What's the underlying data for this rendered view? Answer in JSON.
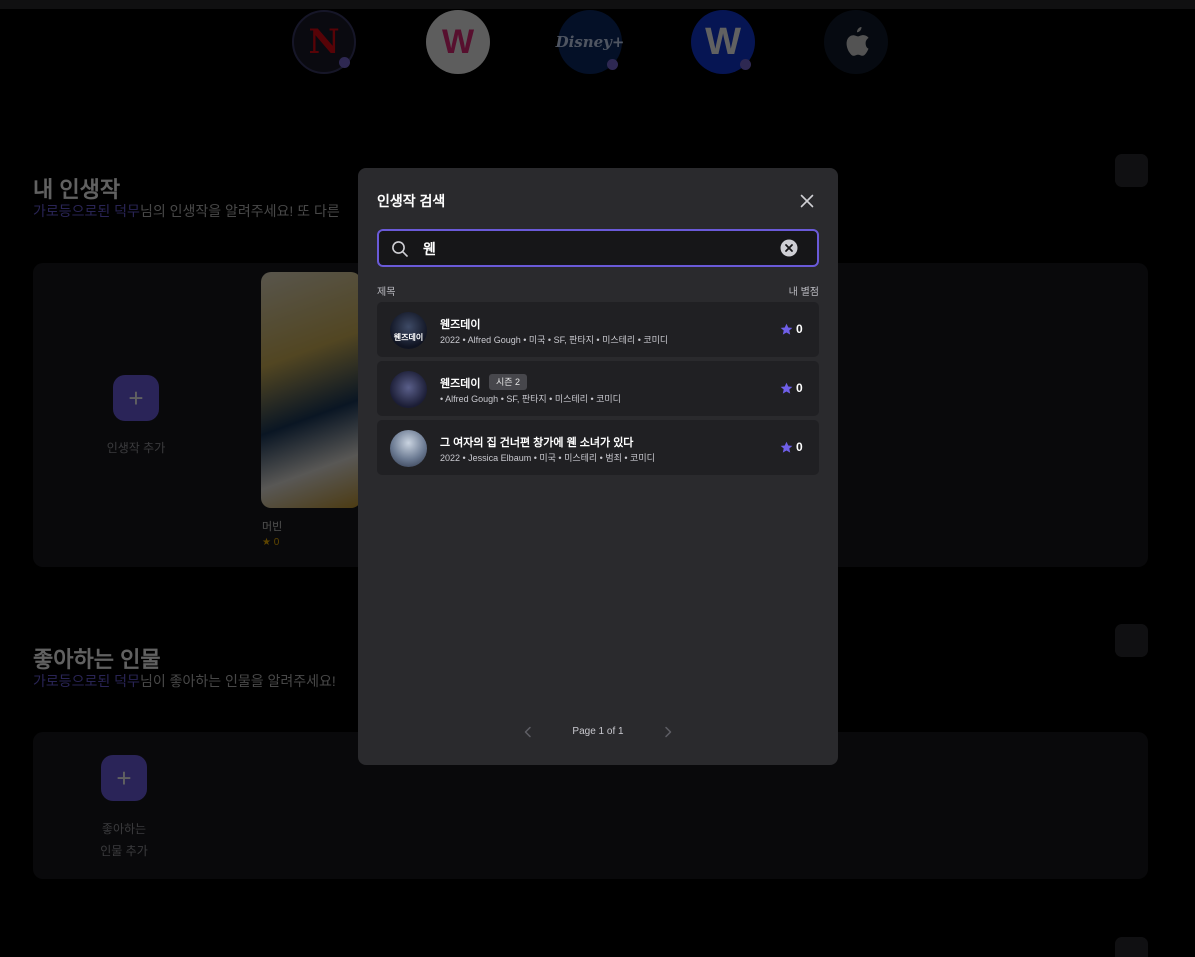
{
  "background": {
    "ott_services": [
      {
        "name": "netflix-logo-icon",
        "glyph": "N"
      },
      {
        "name": "wavve-logo-icon",
        "glyph": "W"
      },
      {
        "name": "disney-plus-logo-icon",
        "glyph": "Disney+"
      },
      {
        "name": "watcha-logo-icon",
        "glyph": "W"
      },
      {
        "name": "apple-tv-logo-icon",
        "glyph": ""
      }
    ],
    "section1": {
      "title": "내 인생작",
      "subtitle_highlight": "가로등으로된 덕무",
      "subtitle_rest": "님의 인생작을 알려주세요! 또 다른",
      "add_label": "인생작 추가",
      "poster_caption": "머빈",
      "poster_rating": "★ 0"
    },
    "section2": {
      "title": "좋아하는 인물",
      "subtitle_highlight": "가로등으로된 덕무",
      "subtitle_rest": "님이 좋아하는 인물을 알려주세요!",
      "add_label_line1": "좋아하는",
      "add_label_line2": "인물 추가"
    }
  },
  "modal": {
    "title": "인생작 검색",
    "search": {
      "value": "웬",
      "placeholder": ""
    },
    "columns": {
      "title": "제목",
      "rating": "내 별점"
    },
    "results": [
      {
        "title": "웬즈데이",
        "badge": "",
        "meta": "2022 • Alfred Gough • 미국 • SF, 판타지 • 미스테리 • 코미디",
        "thumb_text": "웬즈데이",
        "rating": "0"
      },
      {
        "title": "웬즈데이",
        "badge": "시즌 2",
        "meta": "• Alfred Gough • SF, 판타지 • 미스테리 • 코미디",
        "thumb_text": "",
        "rating": "0"
      },
      {
        "title": "그 여자의 집 건너편 창가에 웬 소녀가 있다",
        "badge": "",
        "meta": "2022 • Jessica Elbaum • 미국 • 미스테리 • 범죄 • 코미디",
        "thumb_text": "",
        "rating": "0"
      }
    ],
    "pagination": {
      "label": "Page 1 of 1"
    }
  },
  "colors": {
    "accent": "#6a5ad8",
    "modal_bg": "#2a2a2d",
    "row_bg": "#202023",
    "star": "#6f5fe8"
  }
}
